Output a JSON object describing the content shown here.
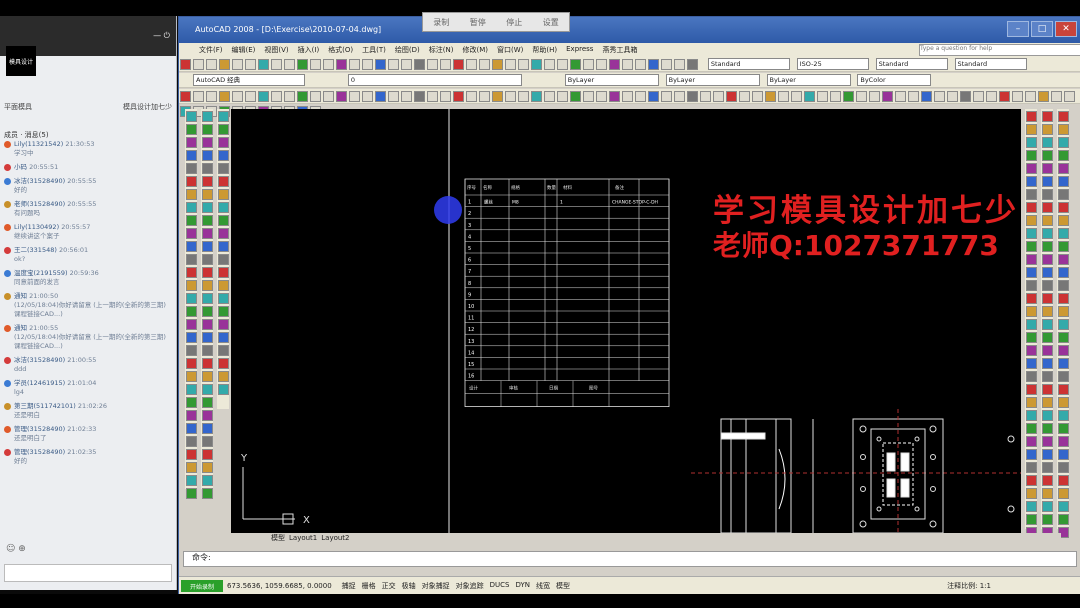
{
  "chat": {
    "header_left": "",
    "header_right": "— ⏻",
    "logo_text": "模具设计",
    "sub_left": "平面模具",
    "sub_right": "模具设计加七少",
    "tabs": "成员 · 消息(5)",
    "messages": [
      {
        "name": "Lily(11321542)",
        "time": "21:30:53",
        "text": "学习中"
      },
      {
        "name": "小码",
        "time": "20:55:51",
        "text": ""
      },
      {
        "name": "冰洁(31528490)",
        "time": "20:55:55",
        "text": "好的"
      },
      {
        "name": "老师(31528490)",
        "time": "20:55:55",
        "text": "有问题吗"
      },
      {
        "name": "Lily(1130492)",
        "time": "20:55:57",
        "text": "继续讲这个案子"
      },
      {
        "name": "王二(331548)",
        "time": "20:56:01",
        "text": "ok?"
      },
      {
        "name": "温度宝(2191559)",
        "time": "20:59:36",
        "text": "同意前面的发言"
      },
      {
        "name": "通知",
        "time": "21:00:50",
        "text": "(12/05/18:04)你好请留意 (上一期的(全新的第三期)课程链接CAD...)"
      },
      {
        "name": "通知",
        "time": "21:00:55",
        "text": "(12/05/18:04)你好请留意 (上一期的(全新的第三期)课程链接CAD...)"
      },
      {
        "name": "冰洁(31528490)",
        "time": "21:00:55",
        "text": "ddd"
      },
      {
        "name": "学员(12461915)",
        "time": "21:01:04",
        "text": "lg4"
      },
      {
        "name": "第三期(511742101)",
        "time": "21:02:26",
        "text": "还是明白"
      },
      {
        "name": "管理(31528490)",
        "time": "21:02:33",
        "text": "还是明白了"
      },
      {
        "name": "管理(31528490)",
        "time": "21:02:35",
        "text": "好的"
      }
    ]
  },
  "recorder": {
    "items": [
      "录制",
      "暂停",
      "停止",
      "设置"
    ]
  },
  "window": {
    "title": "AutoCAD 2008 - [D:\\Exercise\\2010-07-04.dwg]",
    "menu": [
      "文件(F)",
      "编辑(E)",
      "视图(V)",
      "插入(I)",
      "格式(O)",
      "工具(T)",
      "绘图(D)",
      "标注(N)",
      "修改(M)",
      "窗口(W)",
      "帮助(H)",
      "Express",
      "燕秀工具箱"
    ],
    "search_placeholder": "Type a question for help",
    "dropdowns": {
      "workspace": "AutoCAD 经典",
      "layer": "0",
      "color": "ByLayer",
      "linetype": "ByLayer",
      "lineweight": "ByLayer",
      "plotstyle": "ByColor",
      "textstyle": "Standard",
      "dimstyle": "ISO-25",
      "tablestyle": "Standard",
      "mlstyle": "Standard"
    },
    "layout_tabs": [
      "模型",
      "Layout1",
      "Layout2"
    ],
    "command_prompt": "命令:",
    "status": {
      "coords": "673.5636, 1059.6685, 0.0000",
      "toggles": [
        "捕捉",
        "栅格",
        "正交",
        "极轴",
        "对象捕捉",
        "对象追踪",
        "DUCS",
        "DYN",
        "线宽",
        "模型"
      ],
      "right": "注释比例: 1:1"
    },
    "status_green": "开始录制"
  },
  "overlay": {
    "line1": "学习模具设计加七少",
    "line2": "老师Q:1027371773"
  },
  "bom": {
    "header": [
      "序号",
      "名称",
      "规格",
      "数量",
      "材料",
      "备注"
    ],
    "first_row": [
      "1",
      "螺丝",
      "M8",
      "1",
      "CHANGE-STOP-C-DH",
      ""
    ],
    "row_count": 16,
    "footer": [
      "设计",
      "审核",
      "日期",
      "图号"
    ]
  },
  "axis": {
    "x": "X",
    "y": "Y"
  }
}
